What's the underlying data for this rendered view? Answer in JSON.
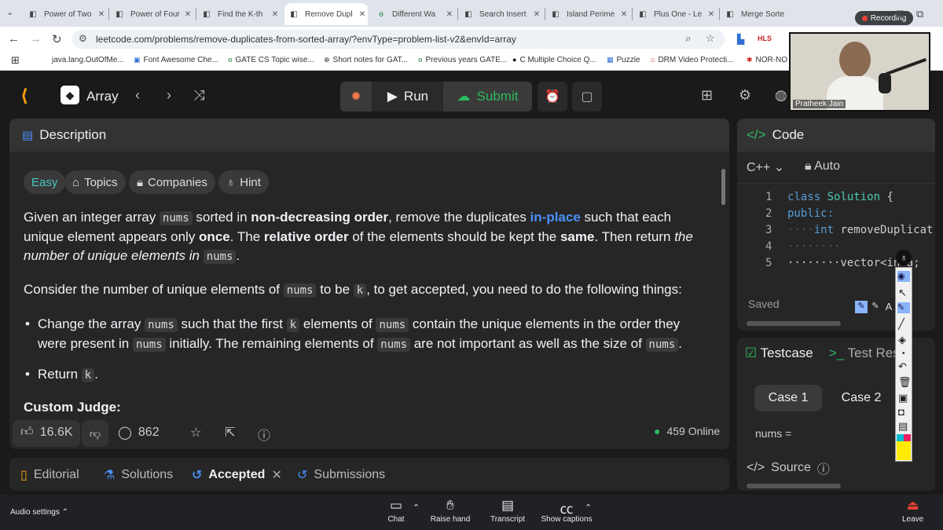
{
  "browser": {
    "tabs": [
      {
        "label": "Power of Two",
        "fav": "G",
        "active": false
      },
      {
        "label": "Power of Four",
        "fav": "G",
        "active": false
      },
      {
        "label": "Find the K-th",
        "fav": "G",
        "active": false
      },
      {
        "label": "Remove Dupl",
        "fav": "G",
        "active": true
      },
      {
        "label": "Different Wa",
        "fav": "ꙩ",
        "active": false
      },
      {
        "label": "Search Insert",
        "fav": "G",
        "active": false
      },
      {
        "label": "Island Perime",
        "fav": "G",
        "active": false
      },
      {
        "label": "Plus One - Le",
        "fav": "G",
        "active": false
      },
      {
        "label": "Merge Sorte",
        "fav": "G",
        "active": false
      }
    ],
    "recording_label": "Recording",
    "url": "leetcode.com/problems/remove-duplicates-from-sorted-array/?envType=problem-list-v2&envId=array",
    "bookmarks": [
      "java.lang.OutOfMe...",
      "Font Awesome Che...",
      "GATE CS Topic wise...",
      "Short notes for GAT...",
      "Previous years GATE...",
      "C Multiple Choice Q...",
      "Puzzle",
      "DRM Video Protecti...",
      "NOR-NO"
    ]
  },
  "header": {
    "list_title": "Array",
    "run_label": "Run",
    "submit_label": "Submit"
  },
  "description": {
    "tab_label": "Description",
    "difficulty": "Easy",
    "tags": [
      "Topics",
      "Companies",
      "Hint"
    ],
    "p1": {
      "a": "Given an integer array ",
      "code1": "nums",
      "b": " sorted in ",
      "bold1": "non-decreasing order",
      "c": ", remove the duplicates ",
      "blue1": "in-place",
      "d": " such that each unique element appears only ",
      "bold2": "once",
      "e": ". The ",
      "bold3": "relative order",
      "f": " of the elements should be kept the ",
      "bold4": "same",
      "g": ". Then return ",
      "ital1": "the number of unique elements in ",
      "code2": "nums",
      "h": "."
    },
    "p2": {
      "a": "Consider the number of unique elements of ",
      "code1": "nums",
      "b": " to be ",
      "code2": "k",
      "c": ", to get accepted, you need to do the following things:"
    },
    "bullet1": {
      "a": "Change the array ",
      "code1": "nums",
      "b": " such that the first ",
      "code2": "k",
      "c": " elements of ",
      "code3": "nums",
      "d": " contain the unique elements in the order they were present in ",
      "code4": "nums",
      "e": " initially. The remaining elements of ",
      "code5": "nums",
      "f": " are not important as well as the size of ",
      "code6": "nums",
      "g": "."
    },
    "bullet2": {
      "a": "Return ",
      "code1": "k",
      "b": "."
    },
    "custom_judge": "Custom Judge:",
    "footer": {
      "likes": "16.6K",
      "comments": "862",
      "online": "459 Online"
    }
  },
  "bottom_tabs": [
    "Editorial",
    "Solutions",
    "Accepted",
    "Submissions"
  ],
  "code_panel": {
    "title": "Code",
    "language": "C++",
    "mode": "Auto",
    "line_numbers": [
      "1",
      "2",
      "3",
      "4",
      "5"
    ],
    "lines": {
      "l1_kw": "class",
      "l1_ty": "Solution",
      "l1_rest": " {",
      "l2": "public:",
      "l3_pre": "····",
      "l3_kw": "int",
      "l3_rest": " removeDuplicat",
      "l4": "········",
      "l5": "········vector<in   a;"
    },
    "saved": "Saved"
  },
  "testcase": {
    "tab_label": "Testcase",
    "result_label": "Test Resu",
    "cases": [
      "Case 1",
      "Case 2"
    ],
    "input_label": "nums =",
    "source_label": "Source"
  },
  "webcam": {
    "name": "Pratheek Jain"
  },
  "meet": {
    "audio": "Audio settings",
    "buttons": [
      "Chat",
      "Raise hand",
      "Transcript",
      "Show captions"
    ],
    "leave": "Leave"
  },
  "colors": {
    "accent_orange": "#ffa116",
    "submit_green": "#2cbb5d",
    "easy_teal": "#46c6c2",
    "link_blue": "#4b8ef7"
  }
}
